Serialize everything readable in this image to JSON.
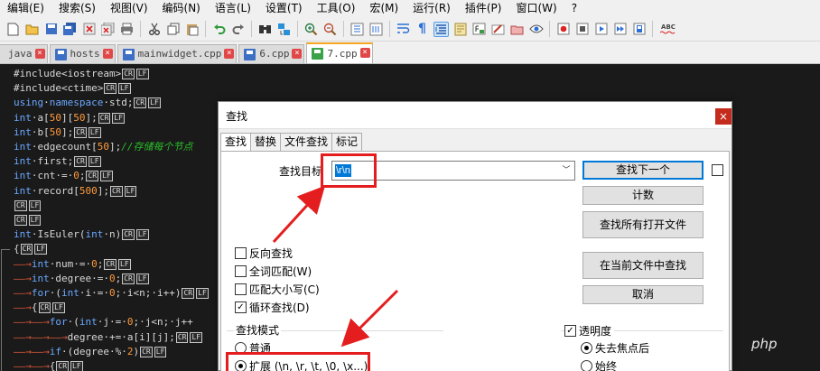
{
  "menubar": {
    "items": [
      "编辑(E)",
      "搜索(S)",
      "视图(V)",
      "编码(N)",
      "语言(L)",
      "设置(T)",
      "工具(O)",
      "宏(M)",
      "运行(R)",
      "插件(P)",
      "窗口(W)",
      "?"
    ]
  },
  "toolbar": {
    "icons": [
      "new-file-icon",
      "open-file-icon",
      "save-icon",
      "save-all-icon",
      "close-icon",
      "close-all-icon",
      "print-icon",
      "cut-icon",
      "copy-icon",
      "paste-icon",
      "undo-icon",
      "redo-icon",
      "find-icon",
      "replace-icon",
      "zoom-in-icon",
      "zoom-out-icon",
      "sync-vertical-icon",
      "sync-horizontal-icon",
      "word-wrap-icon",
      "show-all-chars-icon",
      "indent-guide-icon",
      "doc-map-icon",
      "function-list-icon",
      "folder-workspace-icon",
      "monitor-icon",
      "eye-icon",
      "record-macro-icon",
      "stop-macro-icon",
      "play-macro-icon",
      "run-macro-multiple-icon",
      "save-macro-icon",
      "spell-check-icon"
    ],
    "spell_check_label": "ABC"
  },
  "tabs": [
    {
      "label": "java",
      "active": false
    },
    {
      "label": "hosts",
      "active": false
    },
    {
      "label": "mainwidget.cpp",
      "active": false
    },
    {
      "label": "6.cpp",
      "active": false
    },
    {
      "label": "7.cpp",
      "active": true
    }
  ],
  "editor": {
    "eol_marker_cr": "CR",
    "eol_marker_lf": "LF",
    "lines": [
      {
        "indent": "",
        "segments": [
          {
            "t": "#include<iostream>"
          }
        ],
        "crlf": true
      },
      {
        "indent": "",
        "segments": [
          {
            "t": "#include<ctime>"
          }
        ],
        "crlf": true
      },
      {
        "indent": "",
        "segments": [
          {
            "t": "using",
            "k": "kw"
          },
          {
            "t": "·"
          },
          {
            "t": "namespace",
            "k": "kw"
          },
          {
            "t": "·std;"
          }
        ],
        "crlf": true
      },
      {
        "indent": "",
        "segments": [
          {
            "t": "int",
            "k": "kw"
          },
          {
            "t": "·a["
          },
          {
            "t": "50",
            "k": "num"
          },
          {
            "t": "]["
          },
          {
            "t": "50",
            "k": "num"
          },
          {
            "t": "];"
          }
        ],
        "crlf": true
      },
      {
        "indent": "",
        "segments": [
          {
            "t": "int",
            "k": "kw"
          },
          {
            "t": "·b["
          },
          {
            "t": "50",
            "k": "num"
          },
          {
            "t": "];"
          }
        ],
        "crlf": true
      },
      {
        "indent": "",
        "segments": [
          {
            "t": "int",
            "k": "kw"
          },
          {
            "t": "·edgecount["
          },
          {
            "t": "50",
            "k": "num"
          },
          {
            "t": "];"
          },
          {
            "t": "//存储每个节点",
            "k": "cm"
          }
        ],
        "crlf": false
      },
      {
        "indent": "",
        "segments": [
          {
            "t": "int",
            "k": "kw"
          },
          {
            "t": "·first;"
          }
        ],
        "crlf": true
      },
      {
        "indent": "",
        "segments": [
          {
            "t": "int",
            "k": "kw"
          },
          {
            "t": "·cnt·=·"
          },
          {
            "t": "0",
            "k": "num"
          },
          {
            "t": ";"
          }
        ],
        "crlf": true
      },
      {
        "indent": "",
        "segments": [
          {
            "t": "int",
            "k": "kw"
          },
          {
            "t": "·record["
          },
          {
            "t": "500",
            "k": "num"
          },
          {
            "t": "];"
          }
        ],
        "crlf": true
      },
      {
        "indent": "",
        "segments": [],
        "crlf": true
      },
      {
        "indent": "",
        "segments": [],
        "crlf": true
      },
      {
        "indent": "",
        "segments": [
          {
            "t": "int",
            "k": "kw"
          },
          {
            "t": "·IsEuler("
          },
          {
            "t": "int",
            "k": "kw"
          },
          {
            "t": "·n)"
          }
        ],
        "crlf": true
      },
      {
        "indent": "",
        "segments": [
          {
            "t": "{"
          }
        ],
        "crlf": true
      },
      {
        "indent": "——→",
        "segments": [
          {
            "t": "int",
            "k": "kw"
          },
          {
            "t": "·num·=·"
          },
          {
            "t": "0",
            "k": "num"
          },
          {
            "t": ";"
          }
        ],
        "crlf": true
      },
      {
        "indent": "——→",
        "segments": [
          {
            "t": "int",
            "k": "kw"
          },
          {
            "t": "·degree·=·"
          },
          {
            "t": "0",
            "k": "num"
          },
          {
            "t": ";"
          }
        ],
        "crlf": true
      },
      {
        "indent": "——→",
        "segments": [
          {
            "t": "for",
            "k": "kw"
          },
          {
            "t": "·("
          },
          {
            "t": "int",
            "k": "kw"
          },
          {
            "t": "·i·=·"
          },
          {
            "t": "0",
            "k": "num"
          },
          {
            "t": ";·i<n;·i++)"
          }
        ],
        "crlf": true
      },
      {
        "indent": "——→",
        "segments": [
          {
            "t": "{"
          }
        ],
        "crlf": true
      },
      {
        "indent": "——→——→",
        "segments": [
          {
            "t": "for",
            "k": "kw"
          },
          {
            "t": "·("
          },
          {
            "t": "int",
            "k": "kw"
          },
          {
            "t": "·j·=·"
          },
          {
            "t": "0",
            "k": "num"
          },
          {
            "t": ";·j<n;·j++"
          }
        ],
        "crlf": false
      },
      {
        "indent": "——→——→——→",
        "segments": [
          {
            "t": "degree·+=·a[i][j];"
          }
        ],
        "crlf": true
      },
      {
        "indent": "——→——→",
        "segments": [
          {
            "t": "if",
            "k": "kw"
          },
          {
            "t": "·(degree·%·"
          },
          {
            "t": "2",
            "k": "num"
          },
          {
            "t": ")"
          }
        ],
        "crlf": true
      },
      {
        "indent": "——→——→",
        "segments": [
          {
            "t": "{"
          }
        ],
        "crlf": true
      }
    ]
  },
  "dialog": {
    "title": "查找",
    "close_label": "×",
    "tabs": [
      "查找",
      "替换",
      "文件查找",
      "标记"
    ],
    "find_label": "查找目标",
    "find_value": "\\r\\n",
    "find_arrow": "﹀",
    "buttons": {
      "find_next": "查找下一个",
      "count": "计数",
      "find_all_open": "查找所有打开文件",
      "find_all_current": "在当前文件中查找",
      "cancel": "取消"
    },
    "options": [
      {
        "label": "反向查找",
        "checked": false
      },
      {
        "label": "全词匹配(W)",
        "checked": false
      },
      {
        "label": "匹配大小写(C)",
        "checked": false
      },
      {
        "label": "循环查找(D)",
        "checked": true
      }
    ],
    "search_mode": {
      "title": "查找模式",
      "options": [
        {
          "label": "普通",
          "selected": false
        },
        {
          "label": "扩展 (\\n, \\r, \\t, \\0, \\x...)",
          "selected": true
        }
      ]
    },
    "transparency": {
      "label": "透明度",
      "checked": true,
      "options": [
        {
          "label": "失去焦点后",
          "selected": true
        },
        {
          "label": "始终",
          "selected": false
        }
      ]
    }
  },
  "watermark": "php",
  "colors": {
    "annotation_red": "#e41e1e",
    "selection_blue": "#0078d7",
    "keyword_blue": "#6aa8ff",
    "comment_green": "#29c029",
    "number_orange": "#ff9a3c"
  }
}
